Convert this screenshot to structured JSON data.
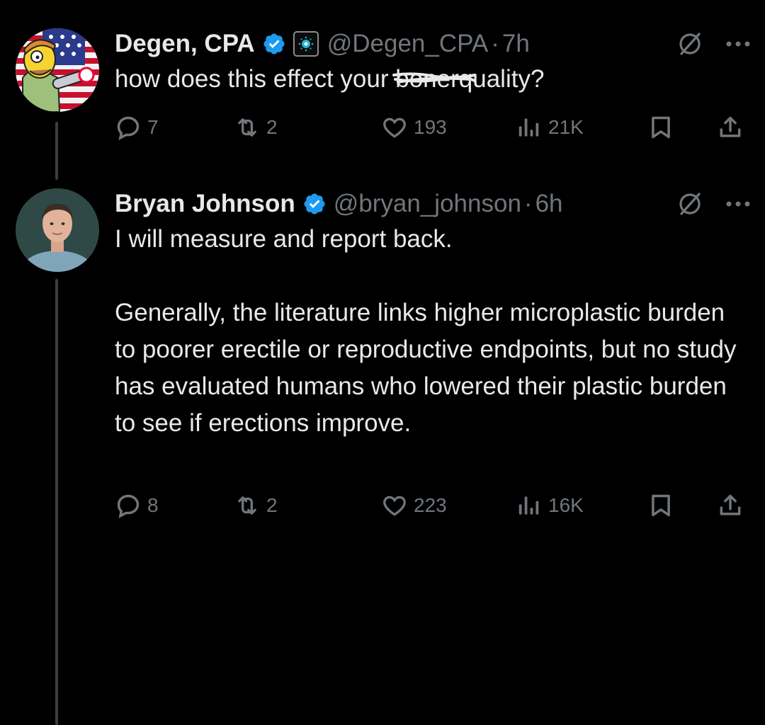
{
  "tweets": [
    {
      "author_name": "Degen, CPA",
      "handle": "@Degen_CPA",
      "time": "7h",
      "text_before": "how does this effect your ",
      "text_struck": "boner",
      "text_after": "quality?",
      "replies": "7",
      "retweets": "2",
      "likes": "193",
      "views": "21K",
      "icons": [
        "avatar-cartoon",
        "verified-badge-icon",
        "affiliate-badge-icon",
        "grok-icon",
        "more-icon",
        "reply-icon",
        "retweet-icon",
        "like-icon",
        "views-icon",
        "bookmark-icon",
        "share-icon"
      ]
    },
    {
      "author_name": "Bryan Johnson",
      "handle": "@bryan_johnson",
      "time": "6h",
      "paragraphs": [
        "I will measure and report back.",
        "Generally, the literature links higher microplastic burden to poorer erectile or reproductive endpoints, but no study has evaluated humans who lowered their plastic burden to see if erections improve."
      ],
      "replies": "8",
      "retweets": "2",
      "likes": "223",
      "views": "16K",
      "icons": [
        "avatar-photo",
        "verified-badge-icon",
        "grok-icon",
        "more-icon",
        "reply-icon",
        "retweet-icon",
        "like-icon",
        "views-icon",
        "bookmark-icon",
        "share-icon"
      ]
    }
  ],
  "colors": {
    "background": "#000000",
    "text": "#e7e9ea",
    "muted": "#71767b",
    "verified": "#1d9bf0"
  }
}
